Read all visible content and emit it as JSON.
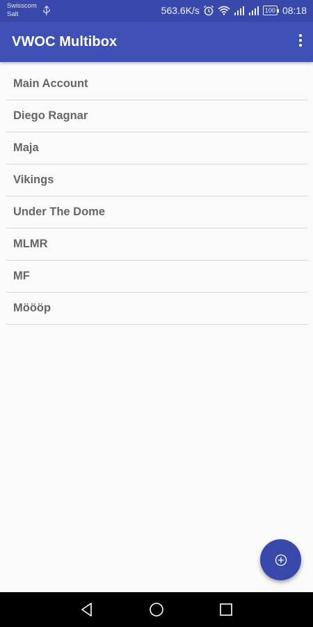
{
  "status_bar": {
    "carrier_line1": "Swisscom",
    "carrier_line2": "Salt",
    "speed": "563.6K/s",
    "battery": "100",
    "time": "08:18"
  },
  "app_bar": {
    "title": "VWOC Multibox",
    "overflow_icon": "more-vert-icon"
  },
  "accounts": [
    {
      "label": "Main Account"
    },
    {
      "label": "Diego Ragnar"
    },
    {
      "label": "Maja"
    },
    {
      "label": "Vikings"
    },
    {
      "label": "Under The Dome"
    },
    {
      "label": "MLMR"
    },
    {
      "label": "MF"
    },
    {
      "label": "Möööp"
    }
  ],
  "fab": {
    "icon": "add-circle-icon"
  },
  "nav_bar": {
    "back_icon": "back-icon",
    "home_icon": "home-icon",
    "recents_icon": "recents-icon"
  },
  "colors": {
    "primary": "#3f51b5",
    "primary_dark": "#3949ab",
    "background": "#fafafa",
    "list_text": "#666666"
  }
}
